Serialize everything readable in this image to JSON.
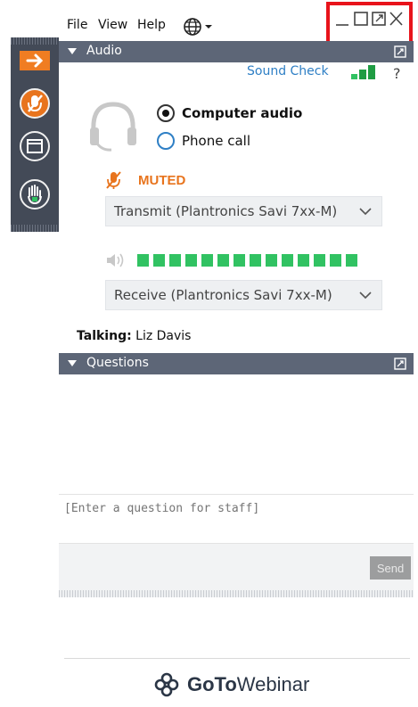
{
  "menu": {
    "file": "File",
    "view": "View",
    "help": "Help",
    "language_icon": "globe-icon"
  },
  "window_controls": [
    "minimize",
    "maximize",
    "popout",
    "close"
  ],
  "audio_panel": {
    "title": "Audio",
    "sound_check": "Sound Check",
    "help": "?",
    "options": [
      {
        "label": "Computer audio",
        "selected": true
      },
      {
        "label": "Phone call",
        "selected": false
      }
    ],
    "mute_status": "MUTED",
    "transmit_device": "Transmit (Plantronics Savi 7xx-M)",
    "receive_device": "Receive (Plantronics Savi 7xx-M)",
    "meter_segments_lit": 14,
    "talking_label": "Talking:",
    "talking_name": "Liz Davis"
  },
  "questions_panel": {
    "title": "Questions",
    "placeholder": "[Enter a question for staff]",
    "send_label": "Send"
  },
  "brand": {
    "logo_bold": "GoTo",
    "logo_regular": "Webinar"
  },
  "colors": {
    "toolbar_bg": "#434a57",
    "header_bg": "#5d6677",
    "accent_orange": "#e8741d",
    "link_blue": "#2e7fc5",
    "meter_green": "#31c262",
    "highlight_red": "#e8131b"
  }
}
